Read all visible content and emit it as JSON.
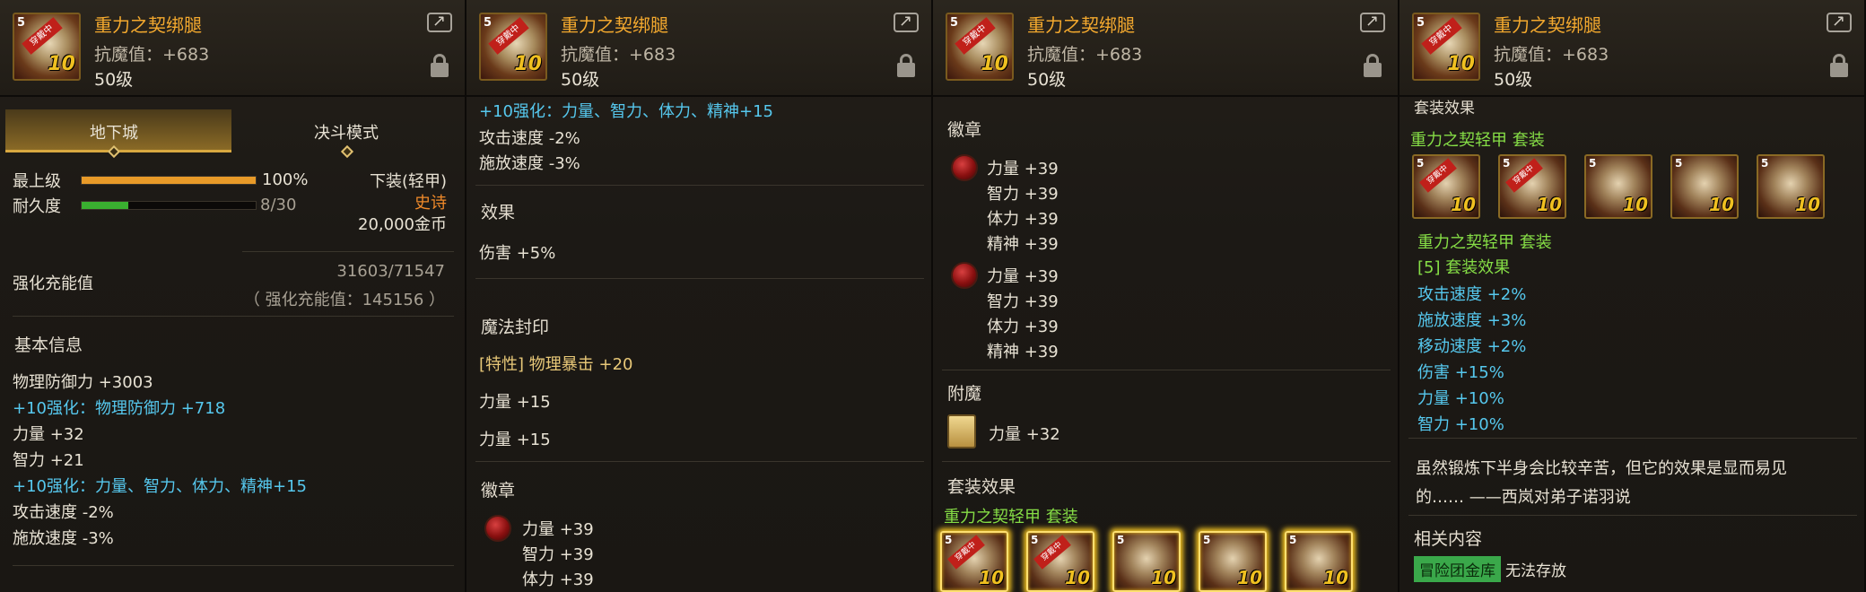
{
  "item": {
    "name": "重力之契绑腿",
    "stat_line": "抗魔值：+683",
    "level": "50级",
    "grade_mark": "5",
    "tag": "穿戴中",
    "reinforce": "10"
  },
  "panel1": {
    "tabs": [
      "地下城",
      "决斗模式"
    ],
    "max_level_label": "最上级",
    "max_level_value": "100%",
    "max_level_fraction": 1.0,
    "durability_label": "耐久度",
    "durability_value": "8/30",
    "durability_fraction": 0.267,
    "slot_type": "下装(轻甲)",
    "rarity": "史诗",
    "price": "20,000金币",
    "charge_label": "强化充能值",
    "charge_value": "31603/71547",
    "charge_note": "（ 强化充能值：145156 ）",
    "basic_info_label": "基本信息",
    "lines": [
      {
        "text": "物理防御力 +3003",
        "style": "white"
      },
      {
        "text": "+10强化：物理防御力 +718",
        "style": "cyan"
      },
      {
        "text": "力量 +32",
        "style": "white"
      },
      {
        "text": "智力 +21",
        "style": "white"
      },
      {
        "text": "+10强化：力量、智力、体力、精神+15",
        "style": "cyan"
      },
      {
        "text": "攻击速度 -2%",
        "style": "white"
      },
      {
        "text": "施放速度 -3%",
        "style": "white"
      }
    ]
  },
  "panel2": {
    "reinforce_line": "+10强化：力量、智力、体力、精神+15",
    "atk_speed": "攻击速度 -2%",
    "cast_speed": "施放速度 -3%",
    "effect_label": "效果",
    "effect": "伤害 +5%",
    "seal_label": "魔法封印",
    "seal_trait": "[特性] 物理暴击 +20",
    "seal_str1": "力量 +15",
    "seal_str2": "力量 +15",
    "emblem_label": "徽章",
    "emblem": [
      "力量 +39",
      "智力 +39",
      "体力 +39"
    ]
  },
  "panel3": {
    "emblem_label": "徽章",
    "emblem_a": [
      "力量 +39",
      "智力 +39",
      "体力 +39",
      "精神 +39"
    ],
    "emblem_b": [
      "力量 +39",
      "智力 +39",
      "体力 +39",
      "精神 +39"
    ],
    "enchant_label": "附魔",
    "enchant": "力量 +32",
    "set_label": "套装效果",
    "set_name": "重力之契轻甲 套装"
  },
  "panel4": {
    "set_label": "套装效果",
    "set_name": "重力之契轻甲 套装",
    "set_name2": "重力之契轻甲 套装",
    "set_bonus_label": "[5] 套装效果",
    "bonuses": [
      "攻击速度 +2%",
      "施放速度 +3%",
      "移动速度 +2%",
      "伤害 +15%",
      "力量 +10%",
      "智力 +10%"
    ],
    "flavor1": "虽然锻炼下半身会比较辛苦，但它的效果是显而易见",
    "flavor2": "的…… ——西岚对弟子诺羽说",
    "related_label": "相关内容",
    "vault_badge": "冒险团金库",
    "vault_note": "无法存放"
  },
  "colors": {
    "title": "#f4a92e",
    "cyan": "#56c8ee",
    "green": "#86de46",
    "orange": "#f08a2a"
  }
}
